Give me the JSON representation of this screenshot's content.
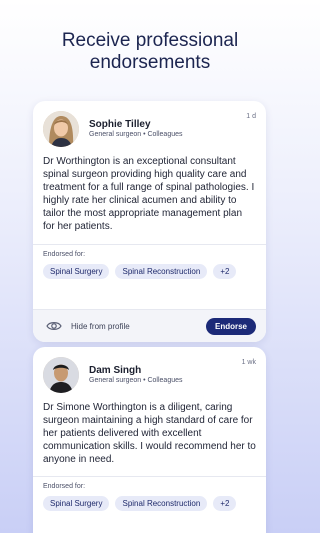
{
  "headline": "Receive professional endorsements",
  "endorsements": [
    {
      "name": "Sophie Tilley",
      "role": "General surgeon • Colleagues",
      "time": "1 d",
      "text": "Dr Worthington is an exceptional consultant spinal surgeon providing high quality care and treatment for a full range of spinal pathologies. I highly rate her clinical acumen and ability to tailor the most appropriate management plan for her patients.",
      "endorsed_for_label": "Endorsed for:",
      "tags": [
        "Spinal Surgery",
        "Spinal Reconstruction",
        "+2"
      ],
      "hide_label": "Hide from profile",
      "endorse_label": "Endorse"
    },
    {
      "name": "Dam Singh",
      "role": "General surgeon • Colleagues",
      "time": "1 wk",
      "text": "Dr Simone Worthington is a diligent, caring surgeon maintaining a high standard of care for her patients delivered with excellent communication skills. I would recommend her to anyone in need.",
      "endorsed_for_label": "Endorsed for:",
      "tags": [
        "Spinal Surgery",
        "Spinal Reconstruction",
        "+2"
      ]
    }
  ]
}
